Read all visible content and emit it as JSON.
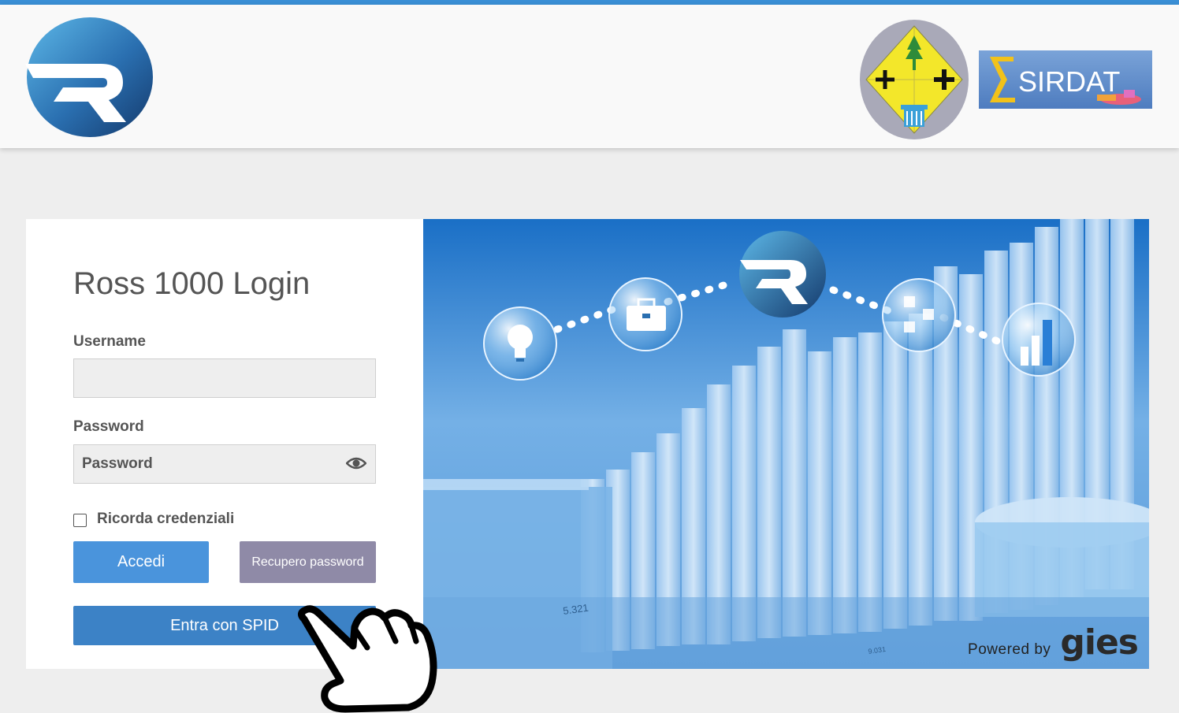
{
  "header": {
    "app_logo": "ross-r-logo",
    "region_logo": "regione-calabria-emblem",
    "sirdat_logo_text": "SIRDAT"
  },
  "login": {
    "title": "Ross 1000 Login",
    "username_label": "Username",
    "username_value": "",
    "password_label": "Password",
    "password_placeholder": "Password",
    "remember_label": "Ricorda credenziali",
    "remember_checked": false,
    "login_button": "Accedi",
    "recover_button": "Recupero password",
    "spid_button": "Entra con SPID"
  },
  "hero": {
    "chart_label_1": "5.321",
    "chart_label_2": "9.031",
    "powered_by": "Powered by",
    "brand": "gies"
  },
  "colors": {
    "top_bar": "#3a8fd6",
    "accedi": "#4a94dc",
    "recupero": "#8f8aa7",
    "spid": "#3c82c6"
  },
  "icons": [
    "eye-icon",
    "lightbulb-icon",
    "briefcase-icon",
    "network-icon",
    "bar-chart-icon",
    "pointing-hand-icon"
  ]
}
